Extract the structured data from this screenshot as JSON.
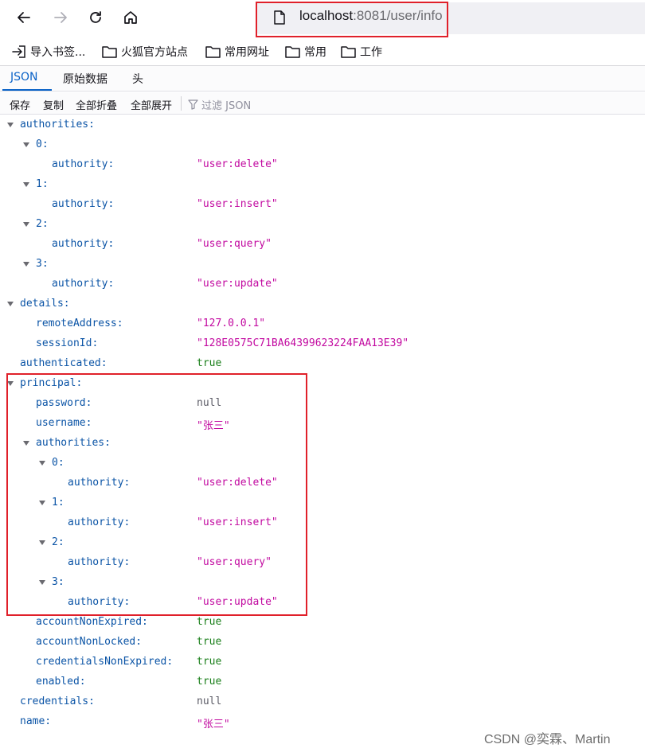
{
  "url": {
    "host": "localhost",
    "rest": ":8081/user/info"
  },
  "bookmarks": [
    {
      "label": "导入书签...",
      "icon": "import-icon"
    },
    {
      "label": "火狐官方站点",
      "icon": "folder-icon"
    },
    {
      "label": "常用网址",
      "icon": "folder-icon"
    },
    {
      "label": "常用",
      "icon": "folder-icon"
    },
    {
      "label": "工作",
      "icon": "folder-icon"
    }
  ],
  "tabs": [
    {
      "label": "JSON",
      "active": true
    },
    {
      "label": "原始数据",
      "active": false
    },
    {
      "label": "头",
      "active": false
    }
  ],
  "toolbar": {
    "save": "保存",
    "copy": "复制",
    "collapse_all": "全部折叠",
    "expand_all": "全部展开",
    "filter_placeholder": "过滤 JSON"
  },
  "json_rows": [
    {
      "key": "authorities:",
      "expandable": true,
      "depth": 0
    },
    {
      "key": "0:",
      "expandable": true,
      "depth": 1
    },
    {
      "key": "authority:",
      "value": "\"user:delete\"",
      "type": "str",
      "depth": 2
    },
    {
      "key": "1:",
      "expandable": true,
      "depth": 1
    },
    {
      "key": "authority:",
      "value": "\"user:insert\"",
      "type": "str",
      "depth": 2
    },
    {
      "key": "2:",
      "expandable": true,
      "depth": 1
    },
    {
      "key": "authority:",
      "value": "\"user:query\"",
      "type": "str",
      "depth": 2
    },
    {
      "key": "3:",
      "expandable": true,
      "depth": 1
    },
    {
      "key": "authority:",
      "value": "\"user:update\"",
      "type": "str",
      "depth": 2
    },
    {
      "key": "details:",
      "expandable": true,
      "depth": 0
    },
    {
      "key": "remoteAddress:",
      "value": "\"127.0.0.1\"",
      "type": "str",
      "depth": 1
    },
    {
      "key": "sessionId:",
      "value": "\"128E0575C71BA64399623224FAA13E39\"",
      "type": "str",
      "depth": 1
    },
    {
      "key": "authenticated:",
      "value": "true",
      "type": "bool",
      "depth": 0
    },
    {
      "key": "principal:",
      "expandable": true,
      "depth": 0
    },
    {
      "key": "password:",
      "value": "null",
      "type": "nul",
      "depth": 1
    },
    {
      "key": "username:",
      "value": "\"张三\"",
      "type": "str",
      "depth": 1
    },
    {
      "key": "authorities:",
      "expandable": true,
      "depth": 1
    },
    {
      "key": "0:",
      "expandable": true,
      "depth": 2
    },
    {
      "key": "authority:",
      "value": "\"user:delete\"",
      "type": "str",
      "depth": 3
    },
    {
      "key": "1:",
      "expandable": true,
      "depth": 2
    },
    {
      "key": "authority:",
      "value": "\"user:insert\"",
      "type": "str",
      "depth": 3
    },
    {
      "key": "2:",
      "expandable": true,
      "depth": 2
    },
    {
      "key": "authority:",
      "value": "\"user:query\"",
      "type": "str",
      "depth": 3
    },
    {
      "key": "3:",
      "expandable": true,
      "depth": 2
    },
    {
      "key": "authority:",
      "value": "\"user:update\"",
      "type": "str",
      "depth": 3
    },
    {
      "key": "accountNonExpired:",
      "value": "true",
      "type": "bool",
      "depth": 1
    },
    {
      "key": "accountNonLocked:",
      "value": "true",
      "type": "bool",
      "depth": 1
    },
    {
      "key": "credentialsNonExpired:",
      "value": "true",
      "type": "bool",
      "depth": 1
    },
    {
      "key": "enabled:",
      "value": "true",
      "type": "bool",
      "depth": 1
    },
    {
      "key": "credentials:",
      "value": "null",
      "type": "nul",
      "depth": 0
    },
    {
      "key": "name:",
      "value": "\"张三\"",
      "type": "str",
      "depth": 0
    }
  ],
  "watermark": "CSDN @奕霖、Martin",
  "colors": {
    "key": "#0b54a6",
    "string": "#c20aa0",
    "boolean": "#1a7f1a",
    "null": "#5b5b66",
    "highlight_border": "#e0202a",
    "active_tab": "#0a62c7"
  }
}
